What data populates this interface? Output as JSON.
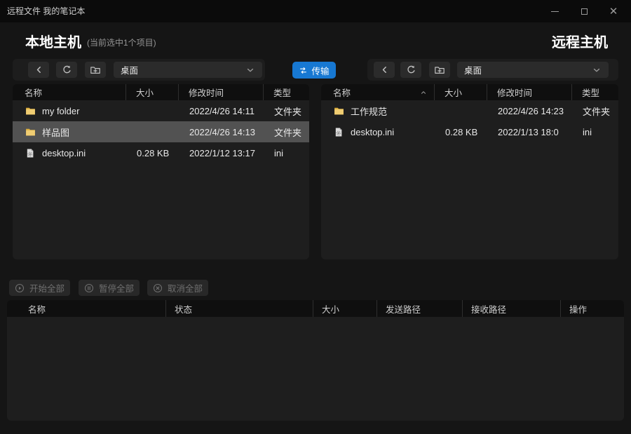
{
  "window": {
    "title": "远程文件 我的笔记本",
    "controls": {
      "minimize": "minimize",
      "maximize": "maximize",
      "close": "×"
    }
  },
  "local_panel": {
    "title": "本地主机",
    "selection_info": "(当前选中1个项目)",
    "path_selected": "桌面",
    "columns": [
      "名称",
      "大小",
      "修改时间",
      "类型"
    ],
    "files": [
      {
        "name": "my folder",
        "size": "",
        "modified": "2022/4/26 14:11",
        "type": "文件夹",
        "icon": "folder",
        "selected": false
      },
      {
        "name": "样品图",
        "size": "",
        "modified": "2022/4/26 14:13",
        "type": "文件夹",
        "icon": "folder",
        "selected": true
      },
      {
        "name": "desktop.ini",
        "size": "0.28 KB",
        "modified": "2022/1/12 13:17",
        "type": "ini",
        "icon": "ini-file",
        "selected": false
      }
    ]
  },
  "remote_panel": {
    "title": "远程主机",
    "path_selected": "桌面",
    "columns": [
      "名称",
      "大小",
      "修改时间",
      "类型"
    ],
    "sorted_column": "名称",
    "sort_direction": "ascending",
    "files": [
      {
        "name": "工作规范",
        "size": "",
        "modified": "2022/4/26 14:23",
        "type": "文件夹",
        "icon": "folder",
        "selected": false
      },
      {
        "name": "desktop.ini",
        "size": "0.28 KB",
        "modified": "2022/1/13 18:0",
        "type": "ini",
        "icon": "ini-file",
        "selected": false
      }
    ]
  },
  "transfer_button": {
    "label": "传输",
    "icon": "swap-arrows"
  },
  "transfer_controls": {
    "start_all": {
      "label": "开始全部",
      "icon": "play-circle",
      "enabled": false
    },
    "pause_all": {
      "label": "暂停全部",
      "icon": "pause-circle",
      "enabled": false
    },
    "cancel_all": {
      "label": "取消全部",
      "icon": "x-circle",
      "enabled": false
    }
  },
  "transfer_table": {
    "columns": [
      "名称",
      "状态",
      "大小",
      "发送路径",
      "接收路径",
      "操作"
    ],
    "rows": []
  },
  "icons": {
    "back": "chevron-left",
    "refresh": "circular-arrow",
    "new_folder": "folder-plus",
    "dropdown": "chevron-down",
    "folder": "yellow-folder",
    "ini-file": "gear-document",
    "sort": "caret-up"
  },
  "colors": {
    "accent": "#1778d2",
    "window_bg": "#151515",
    "panel_bg": "#1e1e1e",
    "header_bg": "#0f0f0f",
    "selected_row": "#525252",
    "titlebar_bg": "#0b0b0b"
  }
}
